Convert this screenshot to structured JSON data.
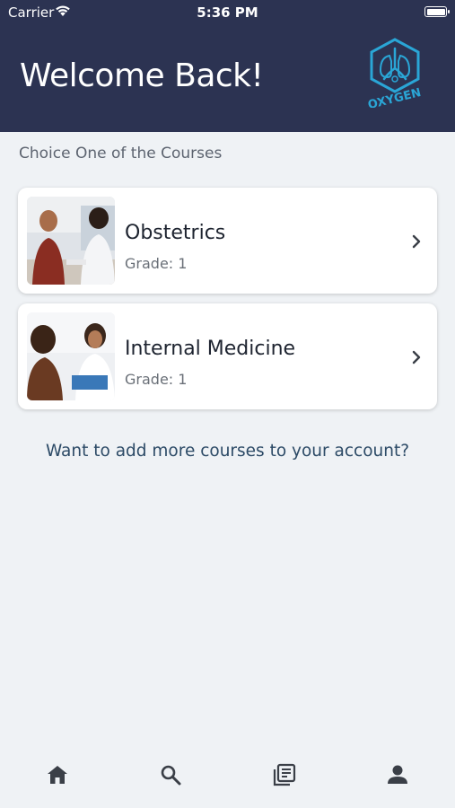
{
  "status_bar": {
    "carrier": "Carrier",
    "time": "5:36 PM"
  },
  "header": {
    "title": "Welcome Back!",
    "logo_text": "OXYGEN"
  },
  "subtitle": "Choice One of the Courses",
  "courses": [
    {
      "name": "Obstetrics",
      "grade": "Grade: 1"
    },
    {
      "name": "Internal Medicine",
      "grade": "Grade: 1"
    }
  ],
  "add_more_link": "Want to add more courses to your account?",
  "tabbar": {
    "items": [
      "home-icon",
      "search-icon",
      "courses-icon",
      "profile-icon"
    ]
  },
  "colors": {
    "header": "#2c3352",
    "background": "#eff2f5",
    "accent": "#2aa6d6",
    "link": "#2c4a66"
  }
}
